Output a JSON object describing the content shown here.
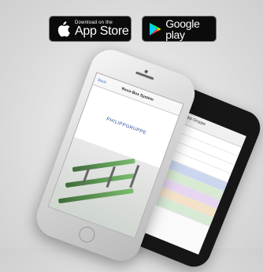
{
  "badges": {
    "apple": {
      "small": "Download on the",
      "big": "App Store",
      "icon": "apple-icon"
    },
    "google": {
      "small": "",
      "big": "Google play",
      "icon": "google-play-icon"
    }
  },
  "phone_front": {
    "nav_back": "Back",
    "nav_title": "Reco-Box System",
    "logo": "PHILIPPGRUPPE"
  },
  "phone_back": {
    "list_title": "Philipp Gruppe",
    "rows": [
      "",
      "",
      "",
      "",
      "",
      "",
      "",
      ""
    ]
  }
}
